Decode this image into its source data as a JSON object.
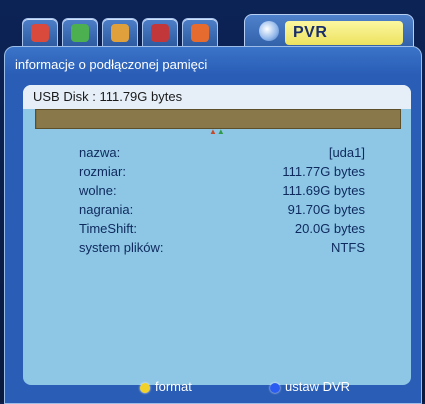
{
  "tabs": {
    "items": [
      {
        "icon": "media-icon",
        "color": "#d94a3c"
      },
      {
        "icon": "tools-icon",
        "color": "#4caf50"
      },
      {
        "icon": "settings-icon",
        "color": "#e0a13c"
      },
      {
        "icon": "card-icon",
        "color": "#c2383a"
      },
      {
        "icon": "disc-icon",
        "color": "#e56b2e"
      }
    ],
    "active_label": "PVR",
    "active_icon": "pvr-icon"
  },
  "panel": {
    "header": "informacje o podłączonej pamięci",
    "disk_label": "USB Disk : 111.79G bytes",
    "usage_fraction": 0.0008,
    "rows": [
      {
        "key": "nazwa:",
        "value": "[uda1]"
      },
      {
        "key": "rozmiar:",
        "value": "111.77G bytes"
      },
      {
        "key": "wolne:",
        "value": "111.69G bytes"
      },
      {
        "key": "nagrania:",
        "value": "91.70G bytes"
      },
      {
        "key": "TimeShift:",
        "value": "20.0G bytes"
      },
      {
        "key": "system plików:",
        "value": "NTFS"
      }
    ]
  },
  "footer": {
    "format_label": "format",
    "dvr_label": "ustaw DVR"
  }
}
